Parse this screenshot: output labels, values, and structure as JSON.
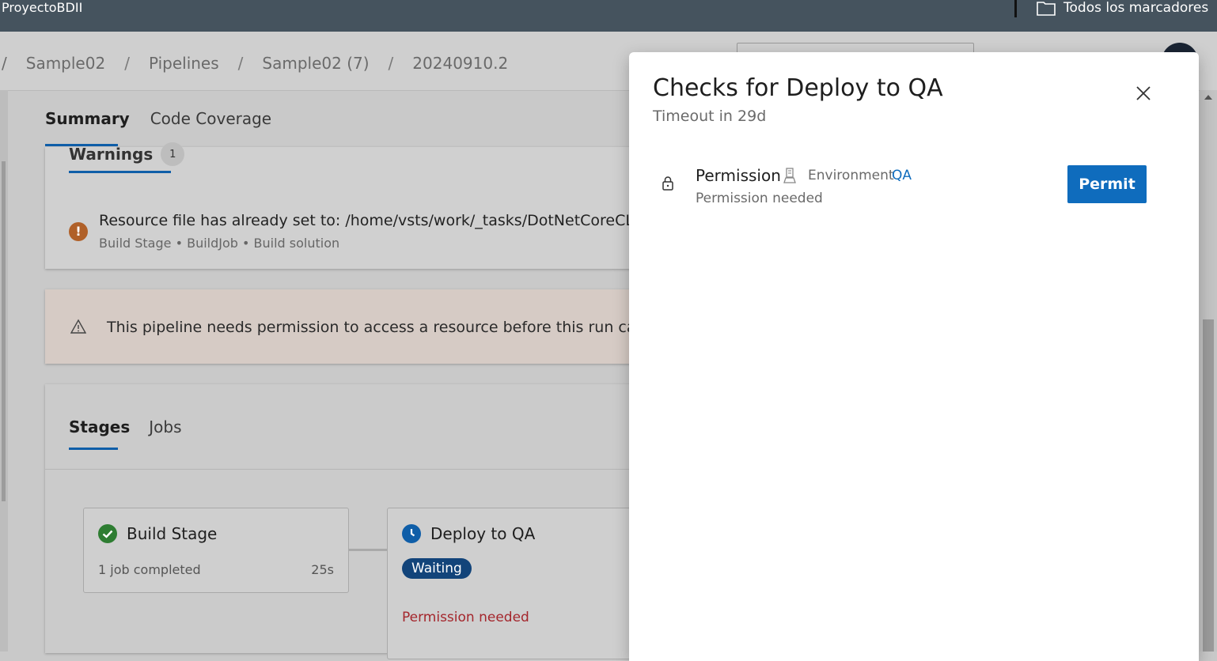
{
  "bookmarks": {
    "left_label": "ProyectoBDII",
    "folder_label": "Todos los marcadores",
    "folder_icon": "folder-icon"
  },
  "breadcrumb": {
    "items": [
      "Sample02",
      "Pipelines",
      "Sample02 (7)",
      "20240910.2"
    ]
  },
  "main_tabs": {
    "summary": "Summary",
    "code_coverage": "Code Coverage"
  },
  "warnings": {
    "tab_label": "Warnings",
    "count": "1",
    "message": "Resource file has already set to: /home/vsts/work/_tasks/DotNetCoreCLI_",
    "source": "Build Stage • BuildJob • Build solution",
    "icon": "error-circle-icon",
    "icon_color": "#b06028"
  },
  "banner": {
    "message": "This pipeline needs permission to access a resource before this run can",
    "icon": "warning-triangle-icon"
  },
  "stages": {
    "tabs": {
      "stages": "Stages",
      "jobs": "Jobs"
    },
    "build": {
      "title": "Build Stage",
      "meta": "1 job completed",
      "duration": "25s",
      "icon": "check-circle-icon"
    },
    "deploy": {
      "title": "Deploy to QA",
      "status": "Waiting",
      "note": "Permission needed",
      "icon": "clock-icon"
    }
  },
  "panel": {
    "title": "Checks for Deploy to QA",
    "subtitle": "Timeout in 29d",
    "check": {
      "name": "Permission",
      "env_label": "Environment",
      "env_link": "QA",
      "status": "Permission needed"
    },
    "permit_label": "Permit",
    "accent": "#0f6cbd"
  }
}
